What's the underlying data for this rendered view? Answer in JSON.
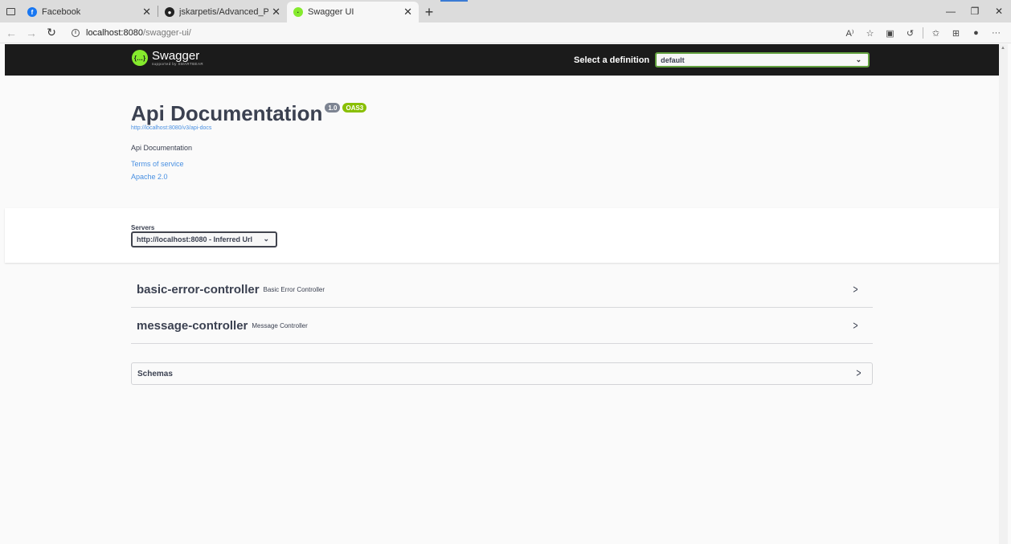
{
  "browser": {
    "tabs": [
      {
        "label": "Facebook"
      },
      {
        "label": "jskarpetis/Advanced_Programmi"
      },
      {
        "label": "Swagger UI"
      }
    ],
    "url_host": "localhost:8080",
    "url_path": "/swagger-ui/"
  },
  "topbar": {
    "logo_text": "Swagger",
    "logo_subtext": "supported by SMARTBEAR",
    "definition_label": "Select a definition",
    "definition_value": "default"
  },
  "info": {
    "title": "Api Documentation",
    "version": "1.0",
    "oas": "OAS3",
    "url": "http://localhost:8080/v3/api-docs",
    "description": "Api Documentation",
    "terms": "Terms of service",
    "license": "Apache 2.0"
  },
  "servers": {
    "label": "Servers",
    "value": "http://localhost:8080 - Inferred Url"
  },
  "controllers": [
    {
      "name": "basic-error-controller",
      "description": "Basic Error Controller"
    },
    {
      "name": "message-controller",
      "description": "Message Controller"
    }
  ],
  "schemas": {
    "label": "Schemas"
  },
  "colors": {
    "topbar_bg": "#1b1b1b",
    "accent_green": "#62a03f",
    "link_blue": "#4990e2",
    "text_dark": "#3b4151",
    "oas_badge": "#89bf04",
    "version_badge": "#7d8492"
  }
}
